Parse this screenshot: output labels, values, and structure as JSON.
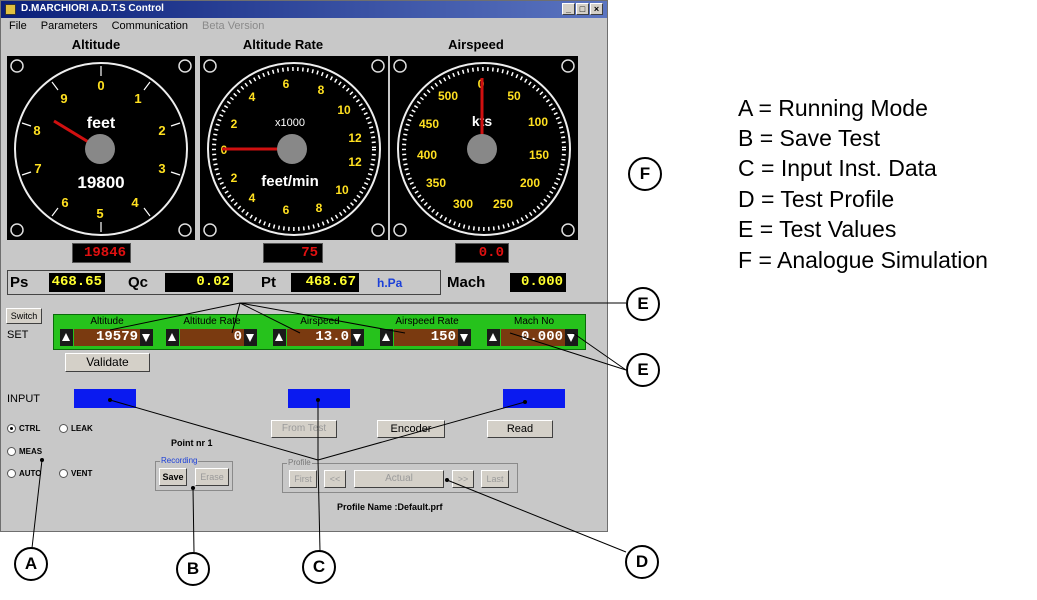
{
  "window": {
    "title": "D.MARCHIORI A.D.T.S Control",
    "controls": {
      "minimize": "_",
      "maximize": "□",
      "close": "×"
    }
  },
  "menu": [
    {
      "label": "File",
      "enabled": true
    },
    {
      "label": "Parameters",
      "enabled": true
    },
    {
      "label": "Communication",
      "enabled": true
    },
    {
      "label": "Beta Version",
      "enabled": false
    }
  ],
  "gauges": {
    "altitude": {
      "title": "Altitude",
      "unit": "feet",
      "center_value": "19800",
      "readout": "19846",
      "dial_labels": [
        "0",
        "1",
        "2",
        "3",
        "4",
        "5",
        "6",
        "7",
        "8",
        "9"
      ]
    },
    "altitude_rate": {
      "title": "Altitude Rate",
      "multiplier": "x1000",
      "unit": "feet/min",
      "readout": "75",
      "dial_labels_top": [
        "4",
        "6",
        "8",
        "10",
        "12"
      ],
      "dial_labels_bottom": [
        "2",
        "4",
        "6",
        "8",
        "10",
        "12"
      ],
      "left_labels": [
        "2",
        "0"
      ]
    },
    "airspeed": {
      "title": "Airspeed",
      "unit": "kts",
      "readout": "0.0",
      "dial_labels": [
        "0",
        "50",
        "100",
        "150",
        "200",
        "250",
        "300",
        "350",
        "400",
        "450",
        "500"
      ]
    }
  },
  "pressures": {
    "ps": {
      "label": "Ps",
      "value": "468.65"
    },
    "qc": {
      "label": "Qc",
      "value": "0.02"
    },
    "pt": {
      "label": "Pt",
      "value": "468.67"
    },
    "unit": "h.Pa",
    "mach": {
      "label": "Mach",
      "value": "0.000"
    }
  },
  "set_panel": {
    "switch_label": "Switch",
    "set_label": "SET",
    "validate_label": "Validate",
    "fields": [
      {
        "label": "Altitude",
        "value": "19579"
      },
      {
        "label": "Altitude Rate",
        "value": "0"
      },
      {
        "label": "Airspeed",
        "value": "13.0"
      },
      {
        "label": "Airspeed Rate",
        "value": "150"
      },
      {
        "label": "Mach No",
        "value": "0.000"
      }
    ]
  },
  "input_panel": {
    "label": "INPUT",
    "buttons": {
      "from_test": "From Test",
      "encoder": "Encoder",
      "read": "Read"
    }
  },
  "modes": [
    {
      "label": "CTRL",
      "selected": true
    },
    {
      "label": "LEAK",
      "selected": false
    },
    {
      "label": "MEAS",
      "selected": false
    },
    {
      "label": "AUTO",
      "selected": false
    },
    {
      "label": "VENT",
      "selected": false
    }
  ],
  "recording": {
    "point_label": "Point nr 1",
    "group_label": "Recording",
    "save": "Save",
    "erase": "Erase"
  },
  "profile": {
    "group_label": "Profile",
    "first": "First",
    "prev": "<<",
    "actual": "Actual",
    "next": ">>",
    "last": "Last",
    "name_label": "Profile Name :Default.prf"
  },
  "legend": [
    "A = Running Mode",
    "B = Save Test",
    "C = Input Inst. Data",
    "D = Test Profile",
    "E = Test Values",
    "F = Analogue Simulation"
  ],
  "callouts": {
    "a": "A",
    "b": "B",
    "c": "C",
    "d": "D",
    "e1": "E",
    "e2": "E",
    "f": "F"
  }
}
